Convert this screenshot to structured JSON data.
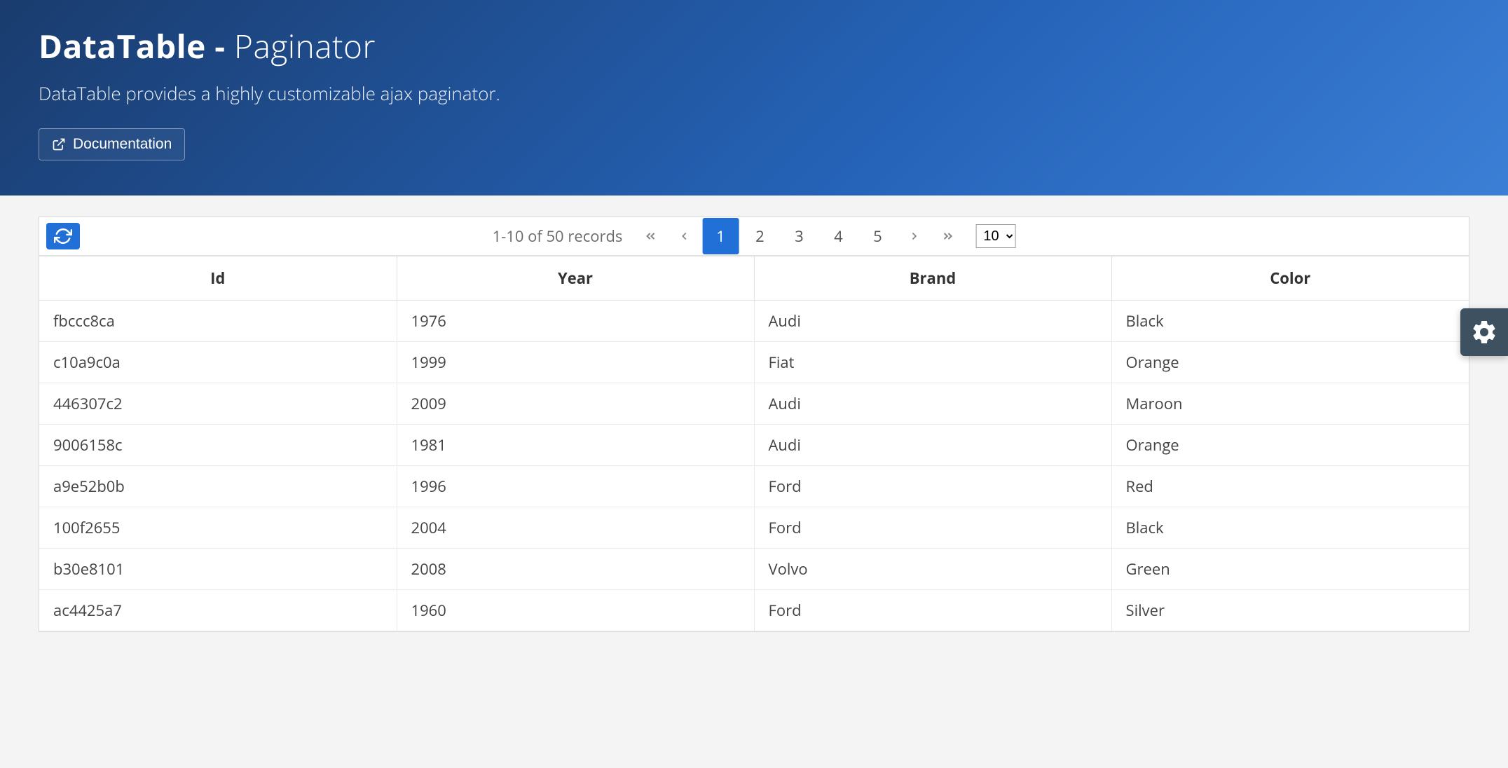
{
  "hero": {
    "title_bold": "DataTable",
    "title_sep": " - ",
    "title_light": "Paginator",
    "subtitle": "DataTable provides a highly customizable ajax paginator.",
    "doc_button": "Documentation"
  },
  "paginator": {
    "status": "1-10 of 50 records",
    "pages": [
      "1",
      "2",
      "3",
      "4",
      "5"
    ],
    "active_page": "1",
    "rows_per_page_options": [
      "10"
    ],
    "rows_per_page_selected": "10"
  },
  "table": {
    "columns": [
      "Id",
      "Year",
      "Brand",
      "Color"
    ],
    "rows": [
      {
        "id": "fbccc8ca",
        "year": "1976",
        "brand": "Audi",
        "color": "Black"
      },
      {
        "id": "c10a9c0a",
        "year": "1999",
        "brand": "Fiat",
        "color": "Orange"
      },
      {
        "id": "446307c2",
        "year": "2009",
        "brand": "Audi",
        "color": "Maroon"
      },
      {
        "id": "9006158c",
        "year": "1981",
        "brand": "Audi",
        "color": "Orange"
      },
      {
        "id": "a9e52b0b",
        "year": "1996",
        "brand": "Ford",
        "color": "Red"
      },
      {
        "id": "100f2655",
        "year": "2004",
        "brand": "Ford",
        "color": "Black"
      },
      {
        "id": "b30e8101",
        "year": "2008",
        "brand": "Volvo",
        "color": "Green"
      },
      {
        "id": "ac4425a7",
        "year": "1960",
        "brand": "Ford",
        "color": "Silver"
      }
    ]
  }
}
